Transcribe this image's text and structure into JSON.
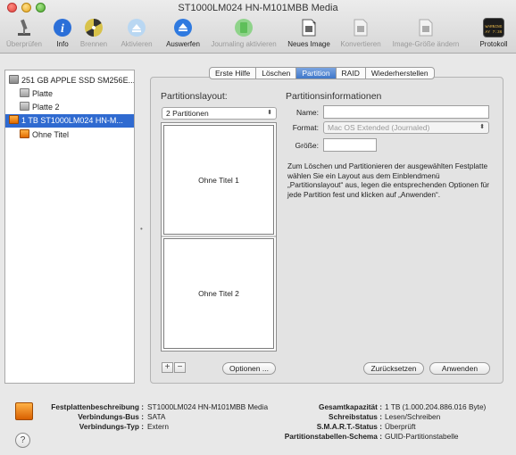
{
  "window": {
    "title": "ST1000LM024 HN-M101MBB Media"
  },
  "toolbar": {
    "items": [
      {
        "label": "Überprüfen",
        "icon": "microscope-icon",
        "enabled": false
      },
      {
        "label": "Info",
        "icon": "info-icon",
        "enabled": true
      },
      {
        "label": "Brennen",
        "icon": "burn-icon",
        "enabled": false
      },
      {
        "label": "Aktivieren",
        "icon": "mount-icon",
        "enabled": false
      },
      {
        "label": "Auswerfen",
        "icon": "eject-icon",
        "enabled": true
      },
      {
        "label": "Journaling aktivieren",
        "icon": "journaling-icon",
        "enabled": false
      },
      {
        "label": "Neues Image",
        "icon": "new-image-icon",
        "enabled": true
      },
      {
        "label": "Konvertieren",
        "icon": "convert-icon",
        "enabled": false
      },
      {
        "label": "Image-Größe ändern",
        "icon": "resize-image-icon",
        "enabled": false
      },
      {
        "label": "Protokoll",
        "icon": "log-icon",
        "enabled": true
      }
    ],
    "log_icon_text": "WARNING\nAY 7:36"
  },
  "sidebar": {
    "items": [
      {
        "label": "251 GB APPLE SSD SM256E...",
        "type": "disk"
      },
      {
        "label": "Platte",
        "type": "volume"
      },
      {
        "label": "Platte 2",
        "type": "volume"
      },
      {
        "label": "1 TB ST1000LM024 HN-M...",
        "type": "external-disk",
        "selected": true
      },
      {
        "label": "Ohne Titel",
        "type": "external-volume"
      }
    ]
  },
  "tabs": [
    "Erste Hilfe",
    "Löschen",
    "Partition",
    "RAID",
    "Wiederherstellen"
  ],
  "active_tab": "Partition",
  "layout": {
    "title": "Partitionslayout:",
    "popup_value": "2 Partitionen",
    "partitions": [
      "Ohne Titel 1",
      "Ohne Titel 2"
    ],
    "add_label": "+",
    "remove_label": "−",
    "options_label": "Optionen ..."
  },
  "info": {
    "title": "Partitionsinformationen",
    "name_label": "Name:",
    "name_value": "",
    "format_label": "Format:",
    "format_value": "Mac OS Extended (Journaled)",
    "size_label": "Größe:",
    "size_value": "",
    "help_text": "Zum Löschen und Partitionieren der ausgewählten Festplatte wählen Sie ein Layout aus dem Einblendmenü „Partitionslayout“ aus, legen die entsprechenden Optionen für jede Partition fest und klicken auf „Anwenden“."
  },
  "buttons": {
    "revert": "Zurücksetzen",
    "apply": "Anwenden"
  },
  "footer": {
    "left": [
      {
        "key": "Festplattenbeschreibung :",
        "value": "ST1000LM024 HN-M101MBB Media"
      },
      {
        "key": "Verbindungs-Bus :",
        "value": "SATA"
      },
      {
        "key": "Verbindungs-Typ :",
        "value": "Extern"
      }
    ],
    "right": [
      {
        "key": "Gesamtkapazität :",
        "value": "1 TB (1.000.204.886.016 Byte)"
      },
      {
        "key": "Schreibstatus :",
        "value": "Lesen/Schreiben"
      },
      {
        "key": "S.M.A.R.T.-Status :",
        "value": "Überprüft"
      },
      {
        "key": "Partitionstabellen-Schema :",
        "value": "GUID-Partitionstabelle"
      }
    ],
    "help": "?"
  }
}
